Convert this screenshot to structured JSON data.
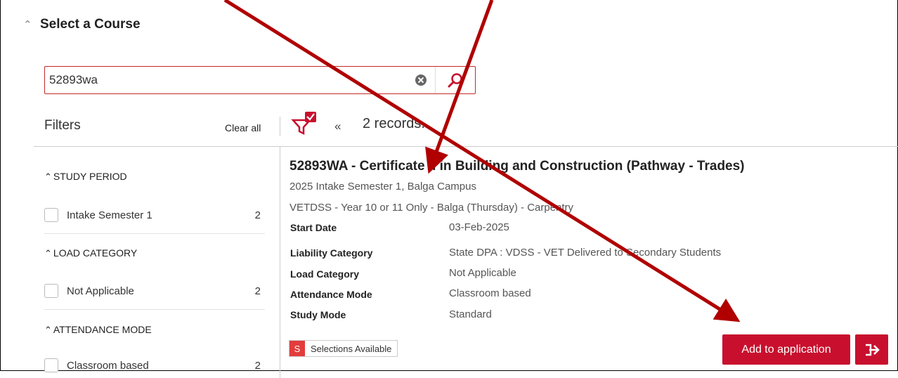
{
  "panel": {
    "title": "Select a Course"
  },
  "search": {
    "value": "52893wa",
    "placeholder": ""
  },
  "filters": {
    "label": "Filters",
    "clear_all": "Clear all",
    "records": "2 records.",
    "groups": [
      {
        "heading": "STUDY PERIOD",
        "option": "Intake Semester 1",
        "count": "2"
      },
      {
        "heading": "LOAD CATEGORY",
        "option": "Not Applicable",
        "count": "2"
      },
      {
        "heading": "ATTENDANCE MODE",
        "option": "Classroom based",
        "count": "2"
      }
    ]
  },
  "course": {
    "title": "52893WA - Certificate II in Building and Construction (Pathway - Trades)",
    "line1": "2025 Intake Semester 1, Balga Campus",
    "line2": "VETDSS - Year 10 or 11 Only - Balga (Thursday) - Carpentry",
    "details": [
      {
        "key": "Start Date",
        "value": "03-Feb-2025"
      },
      {
        "key": "Liability Category",
        "value": "State DPA : VDSS - VET Delivered to Secondary Students"
      },
      {
        "key": "Load Category",
        "value": "Not Applicable"
      },
      {
        "key": "Attendance Mode",
        "value": "Classroom based"
      },
      {
        "key": "Study Mode",
        "value": "Standard"
      }
    ],
    "selections": {
      "badge": "S",
      "label": "Selections Available"
    },
    "add_button": "Add to application"
  },
  "colors": {
    "accent": "#c8102e",
    "annotation_arrow": "#b00000"
  },
  "icons": [
    "chevron-up-icon",
    "clear-circle-icon",
    "search-icon",
    "filter-funnel-icon",
    "double-chevron-up-icon",
    "apply-arrow-icon"
  ]
}
